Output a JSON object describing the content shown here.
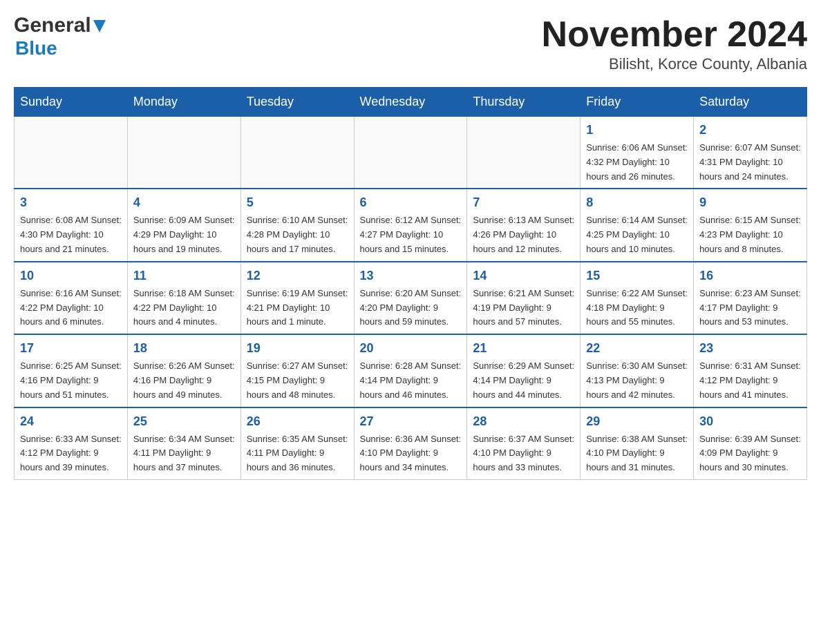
{
  "logo": {
    "general": "General",
    "arrow": "▶",
    "blue": "Blue"
  },
  "title": "November 2024",
  "location": "Bilisht, Korce County, Albania",
  "days": [
    "Sunday",
    "Monday",
    "Tuesday",
    "Wednesday",
    "Thursday",
    "Friday",
    "Saturday"
  ],
  "weeks": [
    [
      {
        "day": "",
        "info": ""
      },
      {
        "day": "",
        "info": ""
      },
      {
        "day": "",
        "info": ""
      },
      {
        "day": "",
        "info": ""
      },
      {
        "day": "",
        "info": ""
      },
      {
        "day": "1",
        "info": "Sunrise: 6:06 AM\nSunset: 4:32 PM\nDaylight: 10 hours and 26 minutes."
      },
      {
        "day": "2",
        "info": "Sunrise: 6:07 AM\nSunset: 4:31 PM\nDaylight: 10 hours and 24 minutes."
      }
    ],
    [
      {
        "day": "3",
        "info": "Sunrise: 6:08 AM\nSunset: 4:30 PM\nDaylight: 10 hours and 21 minutes."
      },
      {
        "day": "4",
        "info": "Sunrise: 6:09 AM\nSunset: 4:29 PM\nDaylight: 10 hours and 19 minutes."
      },
      {
        "day": "5",
        "info": "Sunrise: 6:10 AM\nSunset: 4:28 PM\nDaylight: 10 hours and 17 minutes."
      },
      {
        "day": "6",
        "info": "Sunrise: 6:12 AM\nSunset: 4:27 PM\nDaylight: 10 hours and 15 minutes."
      },
      {
        "day": "7",
        "info": "Sunrise: 6:13 AM\nSunset: 4:26 PM\nDaylight: 10 hours and 12 minutes."
      },
      {
        "day": "8",
        "info": "Sunrise: 6:14 AM\nSunset: 4:25 PM\nDaylight: 10 hours and 10 minutes."
      },
      {
        "day": "9",
        "info": "Sunrise: 6:15 AM\nSunset: 4:23 PM\nDaylight: 10 hours and 8 minutes."
      }
    ],
    [
      {
        "day": "10",
        "info": "Sunrise: 6:16 AM\nSunset: 4:22 PM\nDaylight: 10 hours and 6 minutes."
      },
      {
        "day": "11",
        "info": "Sunrise: 6:18 AM\nSunset: 4:22 PM\nDaylight: 10 hours and 4 minutes."
      },
      {
        "day": "12",
        "info": "Sunrise: 6:19 AM\nSunset: 4:21 PM\nDaylight: 10 hours and 1 minute."
      },
      {
        "day": "13",
        "info": "Sunrise: 6:20 AM\nSunset: 4:20 PM\nDaylight: 9 hours and 59 minutes."
      },
      {
        "day": "14",
        "info": "Sunrise: 6:21 AM\nSunset: 4:19 PM\nDaylight: 9 hours and 57 minutes."
      },
      {
        "day": "15",
        "info": "Sunrise: 6:22 AM\nSunset: 4:18 PM\nDaylight: 9 hours and 55 minutes."
      },
      {
        "day": "16",
        "info": "Sunrise: 6:23 AM\nSunset: 4:17 PM\nDaylight: 9 hours and 53 minutes."
      }
    ],
    [
      {
        "day": "17",
        "info": "Sunrise: 6:25 AM\nSunset: 4:16 PM\nDaylight: 9 hours and 51 minutes."
      },
      {
        "day": "18",
        "info": "Sunrise: 6:26 AM\nSunset: 4:16 PM\nDaylight: 9 hours and 49 minutes."
      },
      {
        "day": "19",
        "info": "Sunrise: 6:27 AM\nSunset: 4:15 PM\nDaylight: 9 hours and 48 minutes."
      },
      {
        "day": "20",
        "info": "Sunrise: 6:28 AM\nSunset: 4:14 PM\nDaylight: 9 hours and 46 minutes."
      },
      {
        "day": "21",
        "info": "Sunrise: 6:29 AM\nSunset: 4:14 PM\nDaylight: 9 hours and 44 minutes."
      },
      {
        "day": "22",
        "info": "Sunrise: 6:30 AM\nSunset: 4:13 PM\nDaylight: 9 hours and 42 minutes."
      },
      {
        "day": "23",
        "info": "Sunrise: 6:31 AM\nSunset: 4:12 PM\nDaylight: 9 hours and 41 minutes."
      }
    ],
    [
      {
        "day": "24",
        "info": "Sunrise: 6:33 AM\nSunset: 4:12 PM\nDaylight: 9 hours and 39 minutes."
      },
      {
        "day": "25",
        "info": "Sunrise: 6:34 AM\nSunset: 4:11 PM\nDaylight: 9 hours and 37 minutes."
      },
      {
        "day": "26",
        "info": "Sunrise: 6:35 AM\nSunset: 4:11 PM\nDaylight: 9 hours and 36 minutes."
      },
      {
        "day": "27",
        "info": "Sunrise: 6:36 AM\nSunset: 4:10 PM\nDaylight: 9 hours and 34 minutes."
      },
      {
        "day": "28",
        "info": "Sunrise: 6:37 AM\nSunset: 4:10 PM\nDaylight: 9 hours and 33 minutes."
      },
      {
        "day": "29",
        "info": "Sunrise: 6:38 AM\nSunset: 4:10 PM\nDaylight: 9 hours and 31 minutes."
      },
      {
        "day": "30",
        "info": "Sunrise: 6:39 AM\nSunset: 4:09 PM\nDaylight: 9 hours and 30 minutes."
      }
    ]
  ]
}
